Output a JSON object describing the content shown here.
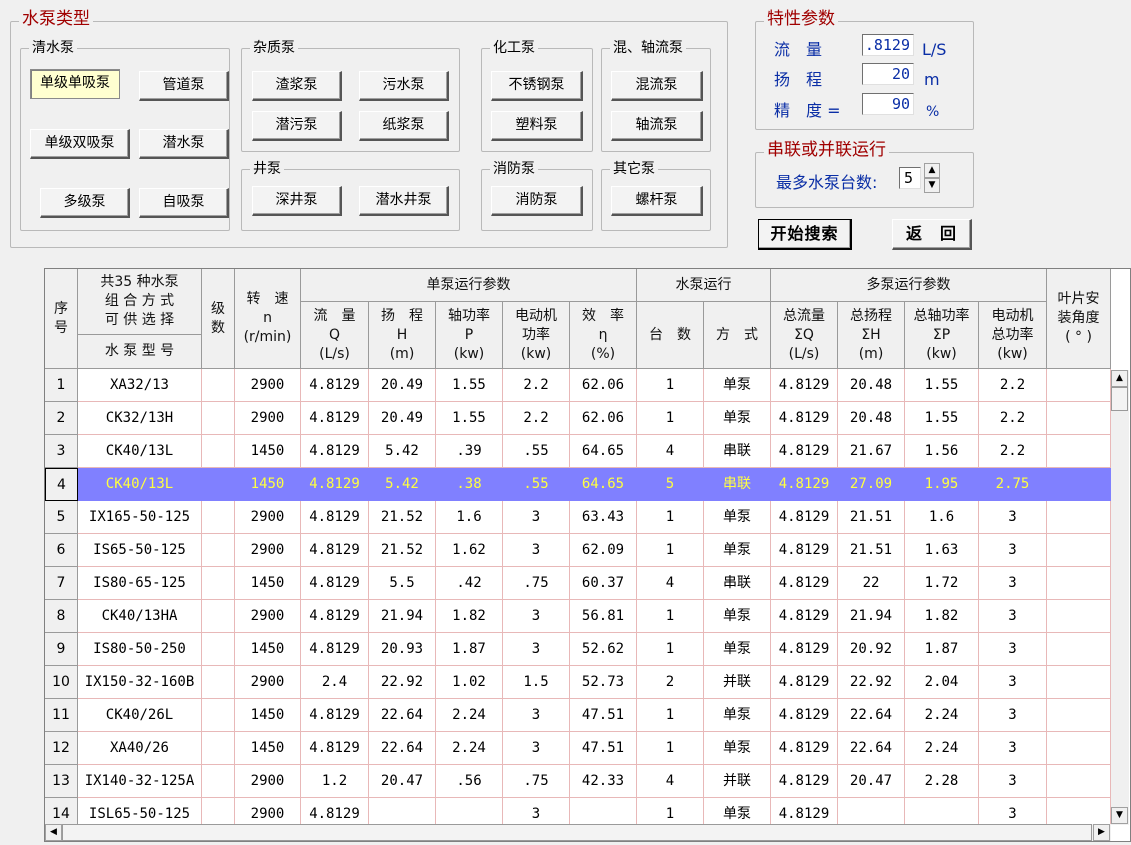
{
  "pump_types": {
    "title": "水泵类型",
    "clear_water": {
      "title": "清水泵",
      "buttons": [
        "单级单吸泵",
        "管道泵",
        "单级双吸泵",
        "潜水泵",
        "多级泵",
        "自吸泵"
      ]
    },
    "impurity": {
      "title": "杂质泵",
      "buttons": [
        "渣浆泵",
        "污水泵",
        "潜污泵",
        "纸浆泵"
      ]
    },
    "chemical": {
      "title": "化工泵",
      "buttons": [
        "不锈钢泵",
        "塑料泵"
      ]
    },
    "mixed_axial": {
      "title": "混、轴流泵",
      "buttons": [
        "混流泵",
        "轴流泵"
      ]
    },
    "well": {
      "title": "井泵",
      "buttons": [
        "深井泵",
        "潜水井泵"
      ]
    },
    "fire": {
      "title": "消防泵",
      "buttons": [
        "消防泵"
      ]
    },
    "other": {
      "title": "其它泵",
      "buttons": [
        "螺杆泵"
      ]
    }
  },
  "characteristics": {
    "title": "特性参数",
    "flow_label": "流　量",
    "flow_value": ".8129",
    "flow_unit": "L/S",
    "head_label": "扬　程",
    "head_value": "20",
    "head_unit": "m",
    "precision_label": "精　度 =",
    "precision_value": "90",
    "precision_unit": "%"
  },
  "series_parallel": {
    "title": "串联或并联运行",
    "max_label": "最多水泵台数:",
    "max_value": "5"
  },
  "actions": {
    "search": "开始搜索",
    "back": "返　回"
  },
  "table": {
    "headers": {
      "seq": [
        "序",
        "号"
      ],
      "combo": [
        "共35 种水泵",
        "组 合 方 式",
        "可 供 选 择"
      ],
      "model": "水 泵 型 号",
      "stage": [
        "级",
        "数"
      ],
      "speed": [
        "转　速",
        "n",
        "(r/min)"
      ],
      "single_group": "单泵运行参数",
      "flow": [
        "流　量",
        "Q",
        "(L/s)"
      ],
      "head": [
        "扬　程",
        "H",
        "(m)"
      ],
      "shaft": [
        "轴功率",
        "P",
        "(kw)"
      ],
      "motor": [
        "电动机",
        "功率",
        "(kw)"
      ],
      "eff": [
        "效　率",
        "η",
        "(%)"
      ],
      "run_group": "水泵运行",
      "count": "台　数",
      "mode": "方　式",
      "multi_group": "多泵运行参数",
      "tflow": [
        "总流量",
        "ΣQ",
        "(L/s)"
      ],
      "thead": [
        "总扬程",
        "ΣH",
        "(m)"
      ],
      "tshaft": [
        "总轴功率",
        "ΣP",
        "(kw)"
      ],
      "tmotor": [
        "电动机",
        "总功率",
        "(kw)"
      ],
      "blade": [
        "叶片安",
        "装角度",
        "( ° )"
      ]
    },
    "rows": [
      [
        "1",
        "XA32/13",
        "",
        "2900",
        "4.8129",
        "20.49",
        "1.55",
        "2.2",
        "62.06",
        "1",
        "单泵",
        "4.8129",
        "20.48",
        "1.55",
        "2.2",
        ""
      ],
      [
        "2",
        "CK32/13H",
        "",
        "2900",
        "4.8129",
        "20.49",
        "1.55",
        "2.2",
        "62.06",
        "1",
        "单泵",
        "4.8129",
        "20.48",
        "1.55",
        "2.2",
        ""
      ],
      [
        "3",
        "CK40/13L",
        "",
        "1450",
        "4.8129",
        "5.42",
        ".39",
        ".55",
        "64.65",
        "4",
        "串联",
        "4.8129",
        "21.67",
        "1.56",
        "2.2",
        ""
      ],
      [
        "4",
        "CK40/13L",
        "",
        "1450",
        "4.8129",
        "5.42",
        ".38",
        ".55",
        "64.65",
        "5",
        "串联",
        "4.8129",
        "27.09",
        "1.95",
        "2.75",
        ""
      ],
      [
        "5",
        "IX165-50-125",
        "",
        "2900",
        "4.8129",
        "21.52",
        "1.6",
        "3",
        "63.43",
        "1",
        "单泵",
        "4.8129",
        "21.51",
        "1.6",
        "3",
        ""
      ],
      [
        "6",
        "IS65-50-125",
        "",
        "2900",
        "4.8129",
        "21.52",
        "1.62",
        "3",
        "62.09",
        "1",
        "单泵",
        "4.8129",
        "21.51",
        "1.63",
        "3",
        ""
      ],
      [
        "7",
        "IS80-65-125",
        "",
        "1450",
        "4.8129",
        "5.5",
        ".42",
        ".75",
        "60.37",
        "4",
        "串联",
        "4.8129",
        "22",
        "1.72",
        "3",
        ""
      ],
      [
        "8",
        "CK40/13HA",
        "",
        "2900",
        "4.8129",
        "21.94",
        "1.82",
        "3",
        "56.81",
        "1",
        "单泵",
        "4.8129",
        "21.94",
        "1.82",
        "3",
        ""
      ],
      [
        "9",
        "IS80-50-250",
        "",
        "1450",
        "4.8129",
        "20.93",
        "1.87",
        "3",
        "52.62",
        "1",
        "单泵",
        "4.8129",
        "20.92",
        "1.87",
        "3",
        ""
      ],
      [
        "10",
        "IX150-32-160B",
        "",
        "2900",
        "2.4",
        "22.92",
        "1.02",
        "1.5",
        "52.73",
        "2",
        "并联",
        "4.8129",
        "22.92",
        "2.04",
        "3",
        ""
      ],
      [
        "11",
        "CK40/26L",
        "",
        "1450",
        "4.8129",
        "22.64",
        "2.24",
        "3",
        "47.51",
        "1",
        "单泵",
        "4.8129",
        "22.64",
        "2.24",
        "3",
        ""
      ],
      [
        "12",
        "XA40/26",
        "",
        "1450",
        "4.8129",
        "22.64",
        "2.24",
        "3",
        "47.51",
        "1",
        "单泵",
        "4.8129",
        "22.64",
        "2.24",
        "3",
        ""
      ],
      [
        "13",
        "IX140-32-125A",
        "",
        "2900",
        "1.2",
        "20.47",
        ".56",
        ".75",
        "42.33",
        "4",
        "并联",
        "4.8129",
        "20.47",
        "2.28",
        "3",
        ""
      ],
      [
        "14",
        "ISL65-50-125",
        "",
        "2900",
        "4.8129",
        "",
        "",
        "3",
        "",
        "1",
        "单泵",
        "4.8129",
        "",
        "",
        "3",
        ""
      ]
    ],
    "selected_row": 4
  }
}
